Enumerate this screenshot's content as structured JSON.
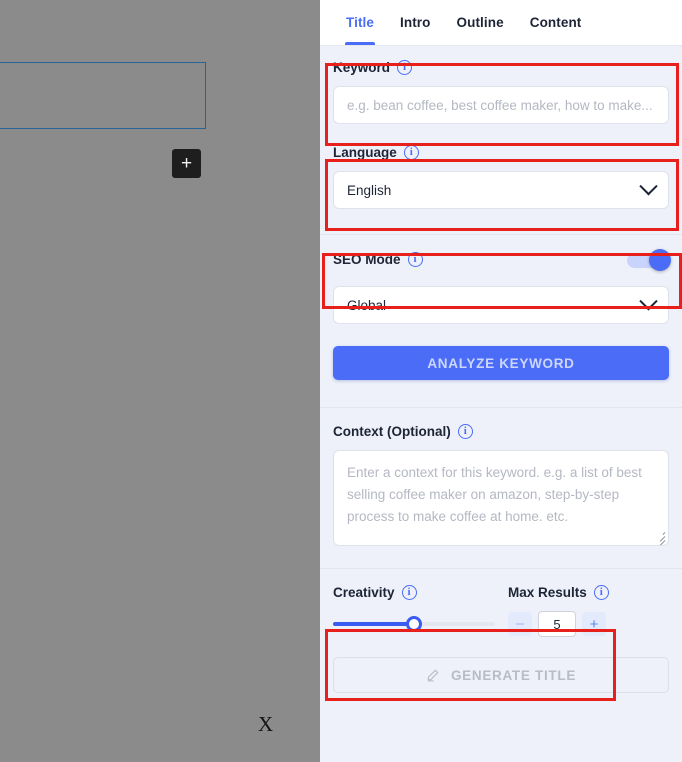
{
  "backdrop": {
    "add_block_icon": "plus-icon",
    "add_block_label": "+",
    "close_label": "X",
    "block_name": "selected-paragraph-block"
  },
  "panel": {
    "tabs": [
      {
        "label": "Title",
        "active": true
      },
      {
        "label": "Intro",
        "active": false
      },
      {
        "label": "Outline",
        "active": false
      },
      {
        "label": "Content",
        "active": false
      }
    ],
    "keyword": {
      "label": "Keyword",
      "info_icon": "info-icon",
      "value": "",
      "placeholder": "e.g. bean coffee, best coffee maker, how to make...",
      "highlighted": true
    },
    "language": {
      "label": "Language",
      "info_icon": "info-icon",
      "selected": "English",
      "chevron_icon": "chevron-down-icon",
      "highlighted": true
    },
    "seo_mode": {
      "label": "SEO Mode",
      "info_icon": "info-icon",
      "enabled": true,
      "highlighted": true
    },
    "region": {
      "selected": "Global",
      "chevron_icon": "chevron-down-icon"
    },
    "analyze_button": {
      "label": "ANALYZE KEYWORD"
    },
    "context": {
      "label": "Context (Optional)",
      "info_icon": "info-icon",
      "value": "",
      "placeholder": "Enter a context for this keyword. e.g. a list of best selling coffee maker on amazon, step-by-step process to make coffee at home. etc.",
      "resize_icon": "resize-grip-icon"
    },
    "creativity": {
      "label": "Creativity",
      "info_icon": "info-icon",
      "value_percent": 50,
      "highlighted": true
    },
    "max_results": {
      "label": "Max Results",
      "info_icon": "info-icon",
      "decrement_label": "−",
      "value": "5",
      "increment_label": "+",
      "highlighted": true
    },
    "generate_button": {
      "label": "GENERATE TITLE",
      "icon": "pencil-icon",
      "disabled": true
    }
  },
  "colors": {
    "accent": "#4a6cf7",
    "panel_bg": "#eef1f9",
    "annotation": "#e8201b",
    "backdrop": "#8b8b8b"
  }
}
